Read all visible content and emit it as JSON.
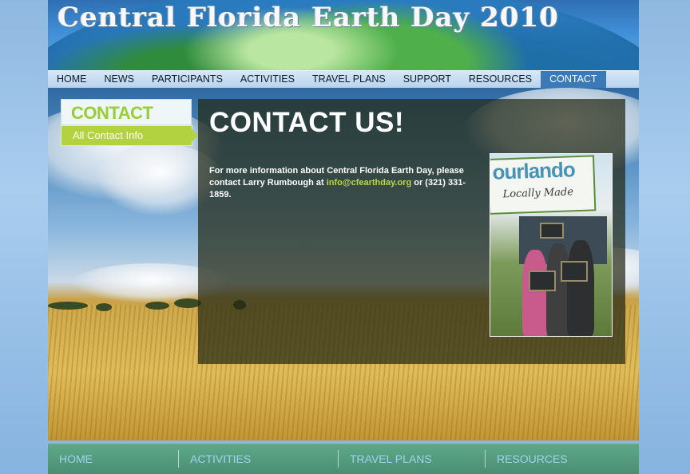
{
  "header": {
    "title": "Central Florida Earth Day 2010"
  },
  "nav": {
    "items": [
      {
        "label": "HOME"
      },
      {
        "label": "NEWS"
      },
      {
        "label": "PARTICIPANTS"
      },
      {
        "label": "ACTIVITIES"
      },
      {
        "label": "TRAVEL PLANS"
      },
      {
        "label": "SUPPORT"
      },
      {
        "label": "RESOURCES"
      },
      {
        "label": "CONTACT",
        "active": true
      }
    ]
  },
  "sidebar": {
    "heading": "CONTACT",
    "link": "All Contact Info"
  },
  "content": {
    "heading": "CONTACT US!",
    "text_before": "For more information about Central Florida Earth Day, please contact Larry Rumbough at ",
    "email": "info@cfearthday.org",
    "text_after": " or (321) 331-1859."
  },
  "photo": {
    "brand": "ourlando",
    "tagline": "Locally Made"
  },
  "footer": {
    "items": [
      {
        "label": "HOME"
      },
      {
        "label": "ACTIVITIES"
      },
      {
        "label": "TRAVEL PLANS"
      },
      {
        "label": "RESOURCES"
      }
    ]
  },
  "colors": {
    "accent_green": "#b2d33f",
    "nav_active": "#3c79b7",
    "footer_bg": "#4a8f73"
  }
}
